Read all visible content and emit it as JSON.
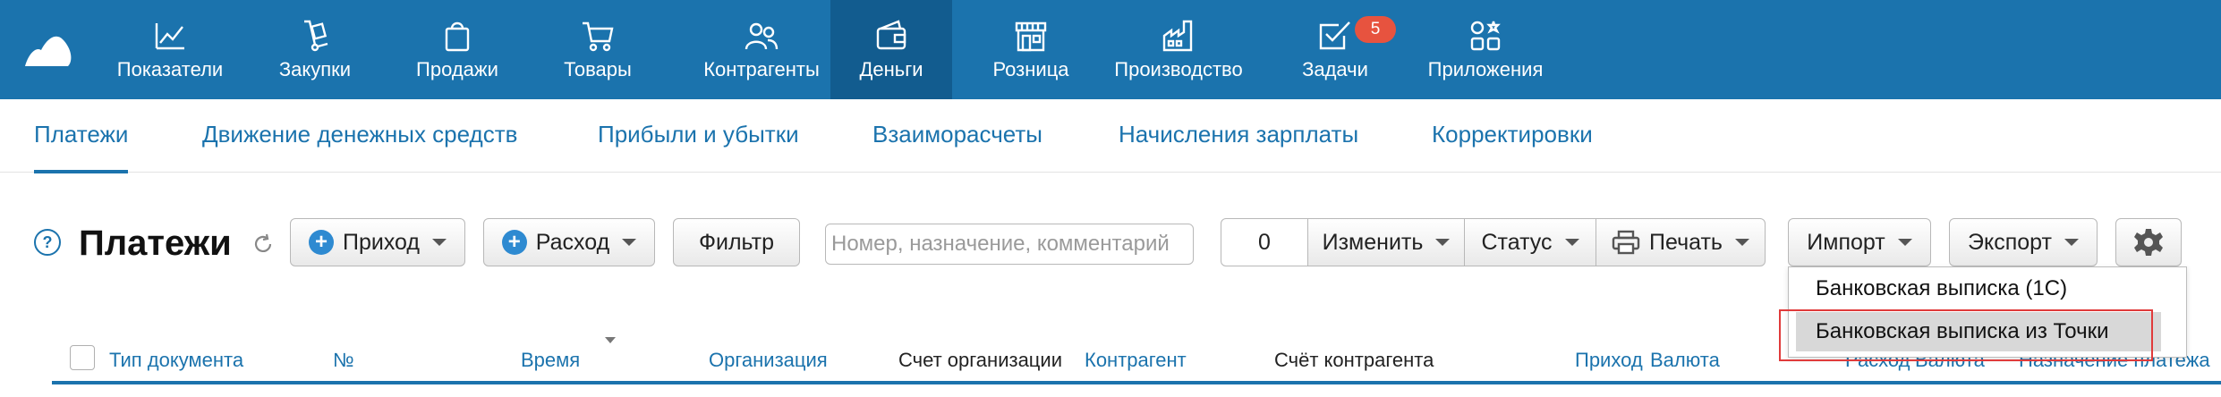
{
  "nav": {
    "items": [
      {
        "label": "Показатели",
        "icon": "chart-line-icon"
      },
      {
        "label": "Закупки",
        "icon": "hand-truck-icon"
      },
      {
        "label": "Продажи",
        "icon": "shopping-bag-icon"
      },
      {
        "label": "Товары",
        "icon": "cart-icon"
      },
      {
        "label": "Контрагенты",
        "icon": "people-icon"
      },
      {
        "label": "Деньги",
        "icon": "wallet-icon",
        "active": true
      },
      {
        "label": "Розница",
        "icon": "storefront-icon"
      },
      {
        "label": "Производство",
        "icon": "factory-icon"
      },
      {
        "label": "Задачи",
        "icon": "task-check-icon",
        "badge": "5"
      },
      {
        "label": "Приложения",
        "icon": "apps-icon"
      }
    ]
  },
  "subtabs": [
    "Платежи",
    "Движение денежных средств",
    "Прибыли и убытки",
    "Взаиморасчеты",
    "Начисления зарплаты",
    "Корректировки"
  ],
  "toolbar": {
    "help": "?",
    "title": "Платежи",
    "income": "Приход",
    "expense": "Расход",
    "filter": "Фильтр",
    "search_placeholder": "Номер, назначение, комментарий",
    "selected_count": "0",
    "change": "Изменить",
    "status": "Статус",
    "print": "Печать",
    "import": "Импорт",
    "export": "Экспорт"
  },
  "import_menu": {
    "items": [
      "Банковская выписка (1С)",
      "Банковская выписка из Точки"
    ]
  },
  "table": {
    "columns": [
      "Тип документа",
      "№",
      "Время",
      "Организация",
      "Счет организации",
      "Контрагент",
      "Счёт контрагента",
      "Приход",
      "Валюта",
      "Расход",
      "Валюта",
      "Назначение платежа"
    ]
  },
  "colors": {
    "brand": "#1b73ad",
    "nav_active": "#125c8f",
    "badge": "#e7533f",
    "highlight_outline": "#e03b3b"
  }
}
